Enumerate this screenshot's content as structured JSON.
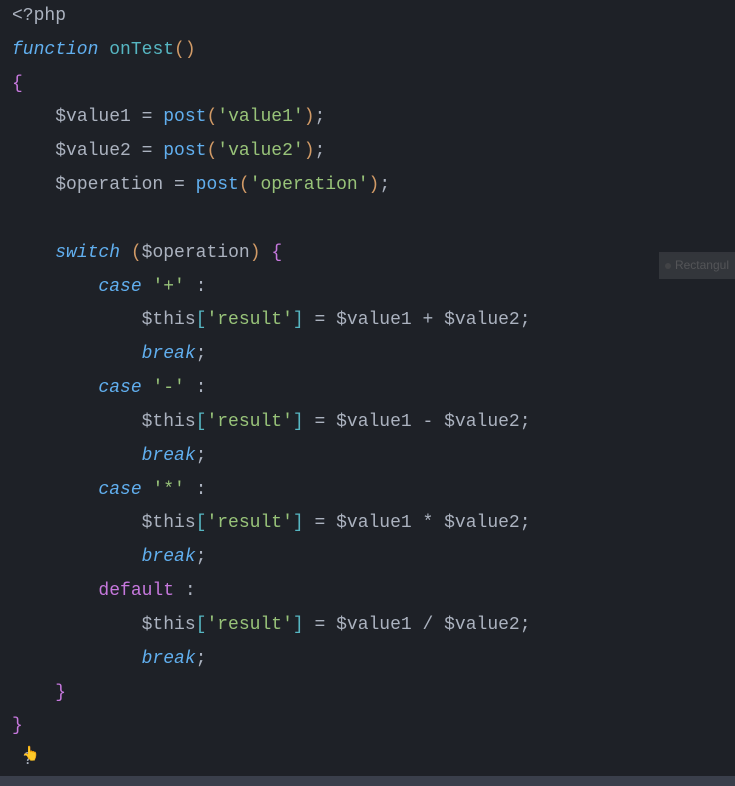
{
  "code": {
    "php_open": "<?php",
    "kw_function": "function",
    "fn_name": "onTest",
    "open_brace": "{",
    "close_brace": "}",
    "var_value1": "$value1",
    "var_value2": "$value2",
    "var_operation": "$operation",
    "var_this": "$this",
    "eq": " = ",
    "call_post": "post",
    "str_value1": "'value1'",
    "str_value2": "'value2'",
    "str_operation": "'operation'",
    "str_result": "'result'",
    "semi": ";",
    "kw_switch": "switch",
    "kw_case": "case",
    "kw_break": "break",
    "kw_default": "default",
    "case_plus": "'+'",
    "case_minus": "'-'",
    "case_star": "'*'",
    "colon": " :",
    "op_plus": " + ",
    "op_minus": " - ",
    "op_star": " * ",
    "op_slash": " / ",
    "qmark": "?"
  },
  "ghost_label": "Rectangul"
}
